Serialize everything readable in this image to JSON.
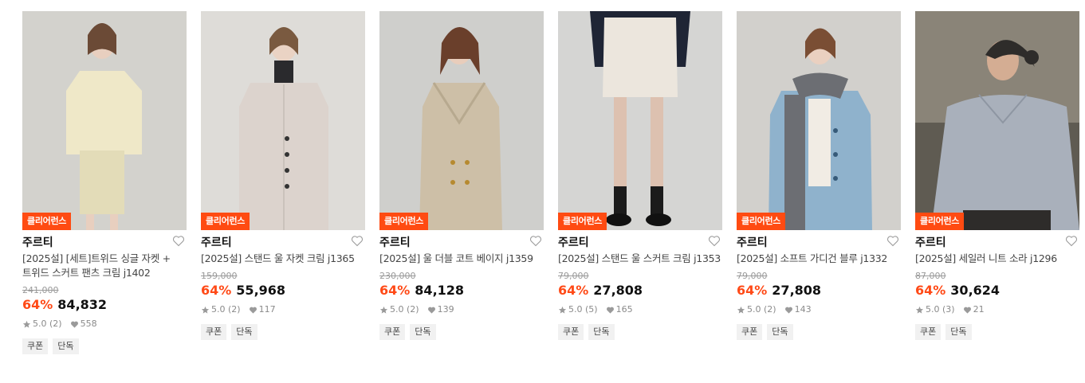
{
  "products": [
    {
      "badge": "클리어런스",
      "brand": "주르티",
      "title": "[2025설] [세트]트위드 싱글 자켓 + 트위드 스커트 팬츠 크림 j1402",
      "original_price": "241,000",
      "discount": "64%",
      "price": "84,832",
      "rating": "5.0 (2)",
      "likes": "558",
      "tags": [
        "쿠폰",
        "단독"
      ],
      "colors": {
        "bg": "#d3d2cd",
        "garment": "#efe8c8",
        "accent": "#e3dcb8"
      }
    },
    {
      "badge": "클리어런스",
      "brand": "주르티",
      "title": "[2025설] 스탠드 울 자켓 크림 j1365",
      "original_price": "159,000",
      "discount": "64%",
      "price": "55,968",
      "rating": "5.0 (2)",
      "likes": "117",
      "tags": [
        "쿠폰",
        "단독"
      ],
      "colors": {
        "bg": "#dedcd8",
        "garment": "#dcd3cd",
        "accent": "#2a2a2d"
      }
    },
    {
      "badge": "클리어런스",
      "brand": "주르티",
      "title": "[2025설] 울 더블 코트 베이지 j1359",
      "original_price": "230,000",
      "discount": "64%",
      "price": "84,128",
      "rating": "5.0 (2)",
      "likes": "139",
      "tags": [
        "쿠폰",
        "단독"
      ],
      "colors": {
        "bg": "#cfcfcc",
        "garment": "#cdbfa7",
        "accent": "#b7a98f"
      }
    },
    {
      "badge": "클리어런스",
      "brand": "주르티",
      "title": "[2025설] 스탠드 울 스커트 크림 j1353",
      "original_price": "79,000",
      "discount": "64%",
      "price": "27,808",
      "rating": "5.0 (5)",
      "likes": "165",
      "tags": [
        "쿠폰",
        "단독"
      ],
      "colors": {
        "bg": "#d5d5d3",
        "garment": "#ece6dd",
        "accent": "#1f2535"
      }
    },
    {
      "badge": "클리어런스",
      "brand": "주르티",
      "title": "[2025설] 소프트 가디건 블루 j1332",
      "original_price": "79,000",
      "discount": "64%",
      "price": "27,808",
      "rating": "5.0 (2)",
      "likes": "143",
      "tags": [
        "쿠폰",
        "단독"
      ],
      "colors": {
        "bg": "#d2d0cc",
        "garment": "#8fb2cc",
        "accent": "#6c6e73"
      }
    },
    {
      "badge": "클리어런스",
      "brand": "주르티",
      "title": "[2025설] 세일러 니트 소라 j1296",
      "original_price": "87,000",
      "discount": "64%",
      "price": "30,624",
      "rating": "5.0 (3)",
      "likes": "21",
      "tags": [
        "쿠폰",
        "단독"
      ],
      "colors": {
        "bg": "#5f5b52",
        "garment": "#a9b0bb",
        "accent": "#2e2c2a"
      }
    }
  ]
}
